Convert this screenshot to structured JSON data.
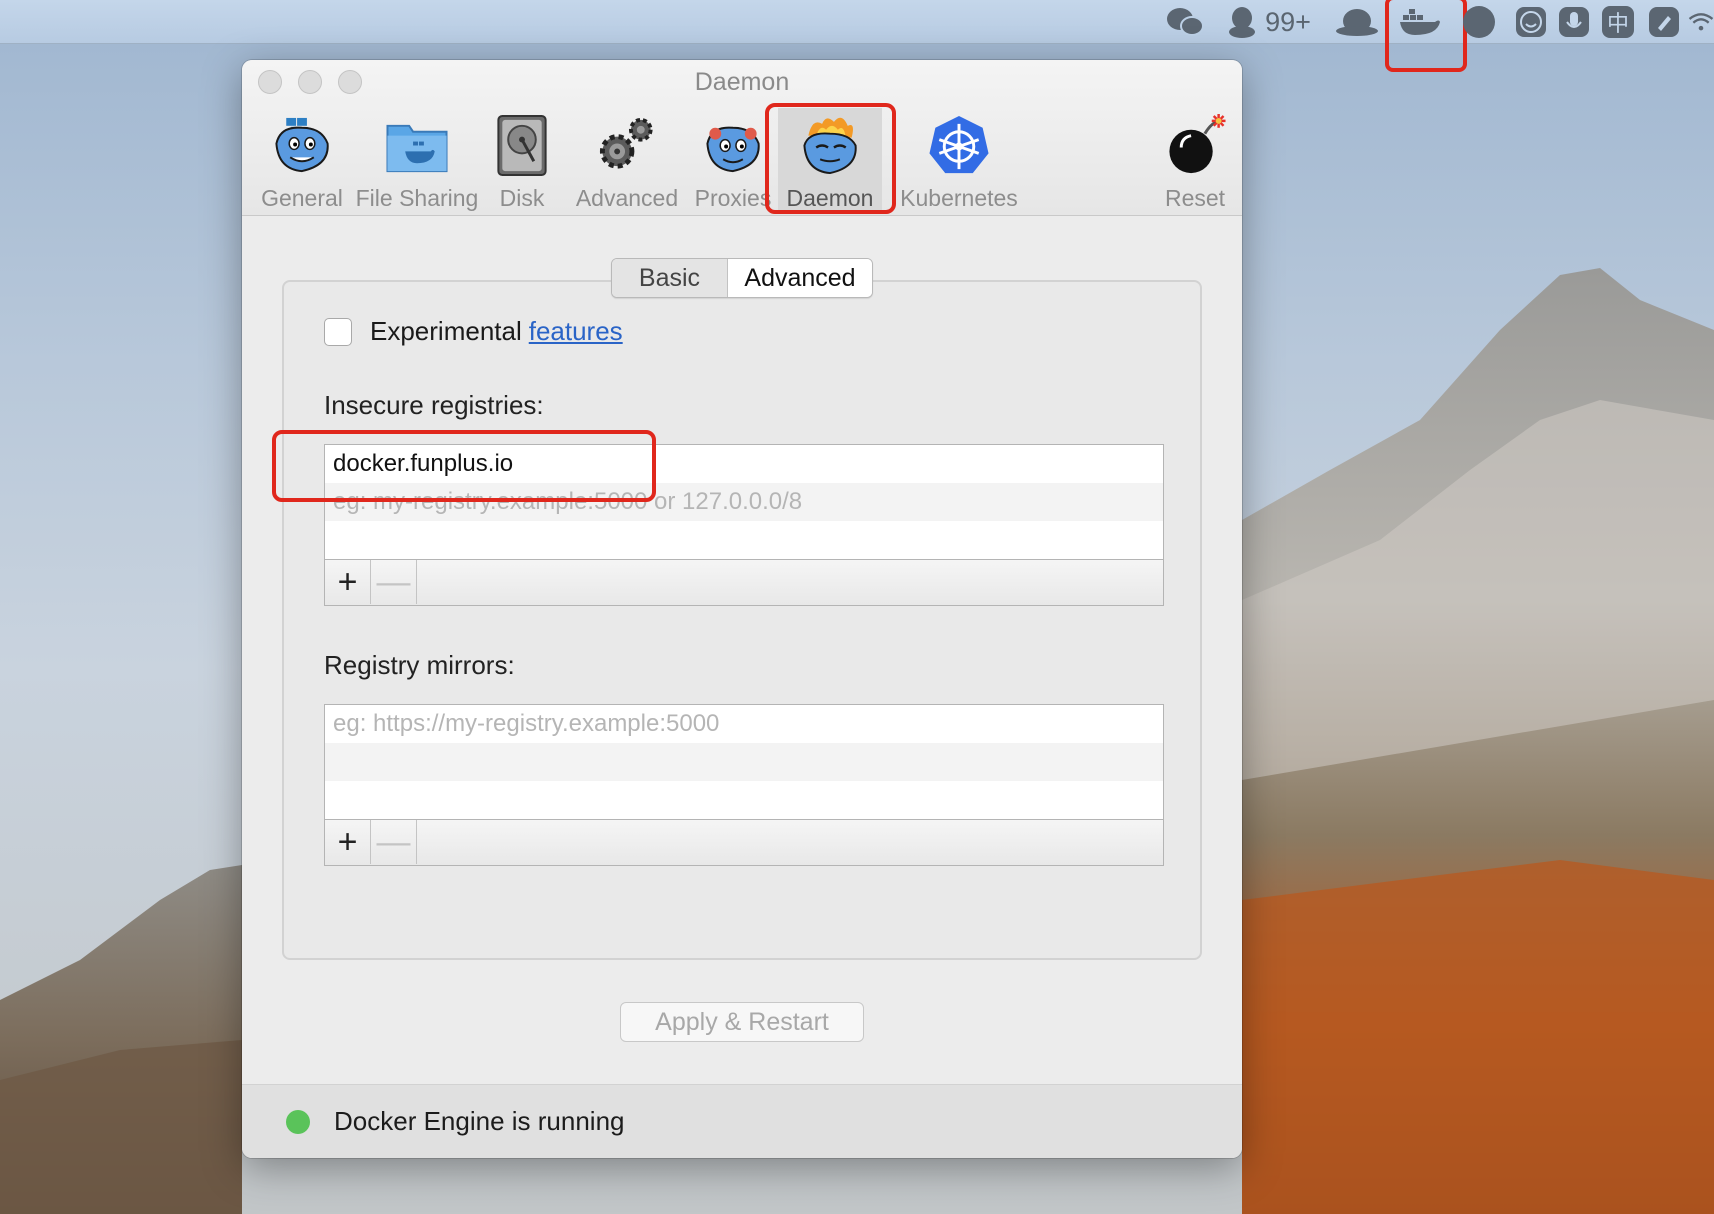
{
  "menubar": {
    "notification_count": "99+",
    "ime_label": "中",
    "icons": [
      "wechat-icon",
      "qq-icon",
      "bowler-hat-icon",
      "docker-whale-icon",
      "circle-app-icon",
      "smiley-icon",
      "microphone-icon",
      "chinese-input-icon",
      "notes-icon",
      "wifi-icon"
    ]
  },
  "window": {
    "title": "Daemon",
    "toolbar": {
      "general": "General",
      "file_sharing": "File Sharing",
      "disk": "Disk",
      "advanced": "Advanced",
      "proxies": "Proxies",
      "daemon": "Daemon",
      "kubernetes": "Kubernetes",
      "reset": "Reset"
    },
    "tabs": {
      "basic": "Basic",
      "advanced": "Advanced",
      "selected": "Advanced"
    },
    "experimental": {
      "label": "Experimental",
      "link": "features",
      "checked": false
    },
    "insecure_registries": {
      "label": "Insecure registries:",
      "items": [
        "docker.funplus.io"
      ],
      "placeholder": "eg: my-registry.example:5000 or 127.0.0.0/8"
    },
    "registry_mirrors": {
      "label": "Registry mirrors:",
      "items": [],
      "placeholder": "eg: https://my-registry.example:5000"
    },
    "list_buttons": {
      "add": "+",
      "remove": "—"
    },
    "apply_button": "Apply & Restart",
    "status": {
      "text": "Docker Engine is running",
      "color": "#5ac35a"
    }
  },
  "colors": {
    "highlight_box": "#e0271c",
    "link": "#2a64c7"
  }
}
